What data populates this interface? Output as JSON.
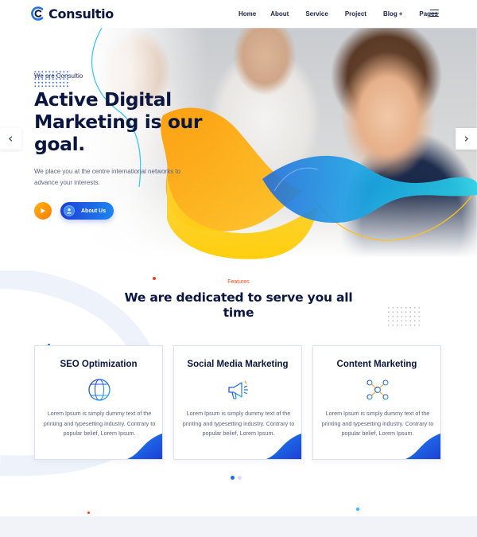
{
  "brand": {
    "name": "Consultio"
  },
  "nav": {
    "items": [
      "Home",
      "About",
      "Service",
      "Project",
      "Blog",
      "Pages"
    ],
    "blog_plus": "+"
  },
  "hero": {
    "eyebrow": "We are Consultio",
    "title": "Active Digital Marketing is our goal.",
    "description": "We place you at the centre international networks to advance your interests.",
    "cta_label": "About Us"
  },
  "features": {
    "eyebrow": "Features",
    "title": "We are dedicated to serve you all time",
    "cards": [
      {
        "title": "SEO Optimization",
        "icon": "globe-icon",
        "text": "Lorem Ipsum is simply dummy text of the printing and typesetting industry. Contrary to popular belief, Lorem Ipsum."
      },
      {
        "title": "Social Media Marketing",
        "icon": "megaphone-icon",
        "text": "Lorem Ipsum is simply dummy text of the printing and typesetting industry. Contrary to popular belief, Lorem Ipsum."
      },
      {
        "title": "Content Marketing",
        "icon": "network-users-icon",
        "text": "Lorem Ipsum is simply dummy text of the printing and typesetting industry. Contrary to popular belief, Lorem Ipsum."
      }
    ],
    "pager": {
      "count": 2,
      "active": 0
    }
  },
  "colors": {
    "brand_navy": "#0b1640",
    "accent_blue": "#1d6fe8",
    "accent_orange": "#ff9a00",
    "accent_yellow": "#ffd400",
    "accent_red": "#ff4a1c",
    "accent_cyan": "#2ec4ff"
  }
}
